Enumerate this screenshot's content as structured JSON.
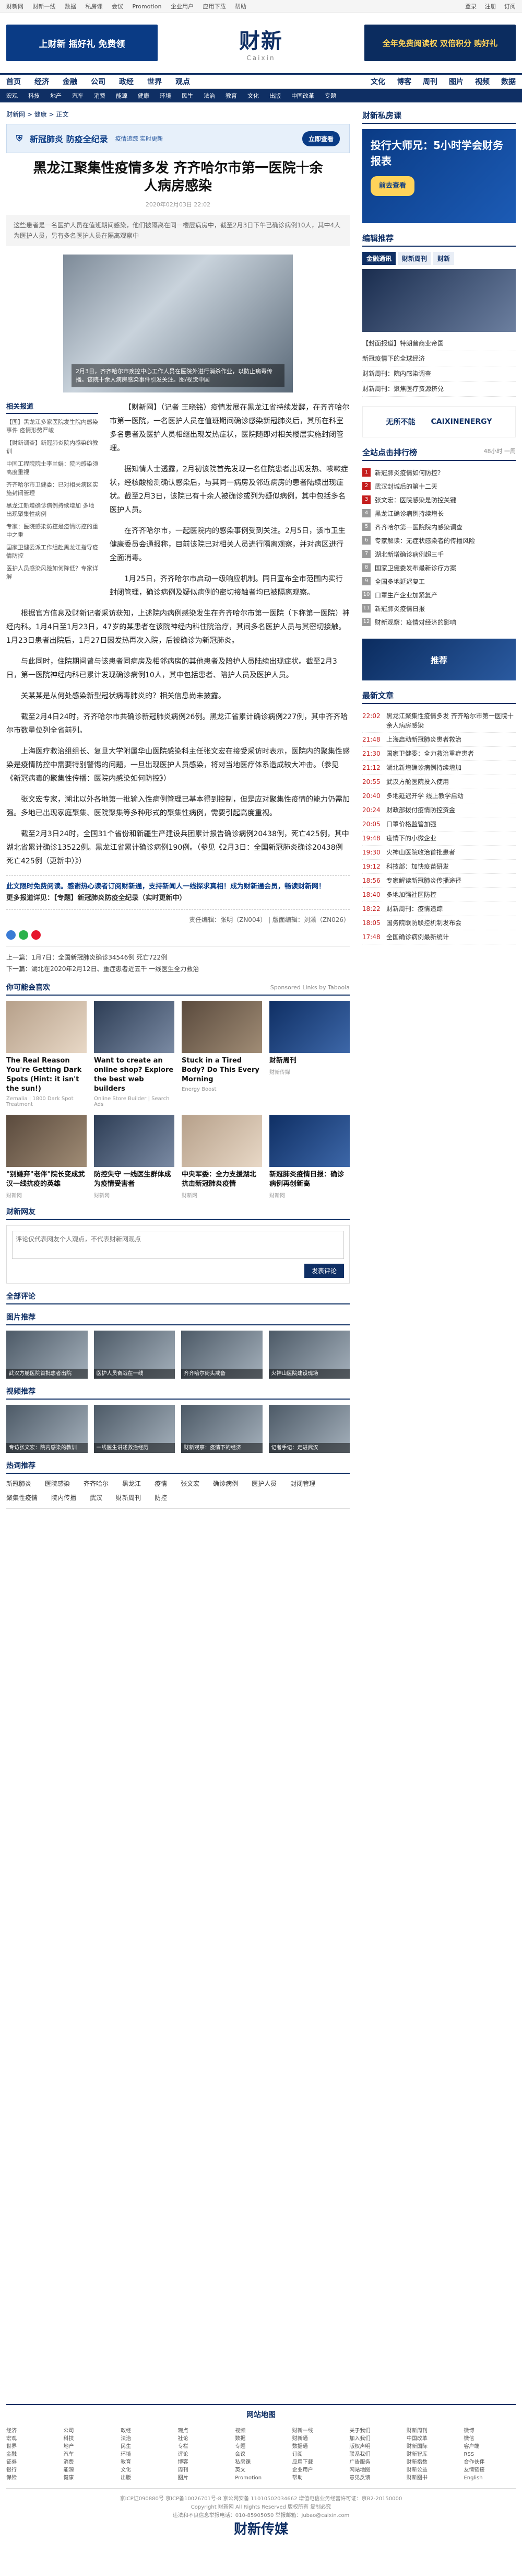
{
  "topbar": {
    "links": [
      "财新网",
      "财新一线",
      "数据",
      "私房课",
      "会议",
      "Promotion",
      "企业用户",
      "应用下载",
      "帮助"
    ],
    "login": "登录",
    "register": "注册",
    "subscribe": "订阅"
  },
  "header": {
    "left_banner": "上财新 摇好礼 免费领",
    "logo_cn": "财新",
    "logo_en": "Caixin",
    "right_banner": "全年免费阅读权 双倍积分 购好礼"
  },
  "nav1": {
    "items": [
      "首页",
      "经济",
      "金融",
      "公司",
      "政经",
      "世界",
      "观点"
    ],
    "right": [
      "文化",
      "博客",
      "周刊",
      "图片",
      "视频",
      "数据"
    ]
  },
  "nav2": {
    "items": [
      "宏观",
      "科技",
      "地产",
      "汽车",
      "消费",
      "能源",
      "健康",
      "环境",
      "民生",
      "法治",
      "教育",
      "文化",
      "出版",
      "中国改革",
      "专题"
    ]
  },
  "breadcrumb": "财新网 > 健康 > 正文",
  "adbar": {
    "title": "新冠肺炎 防疫全纪录",
    "sub": "疫情追踪 实时更新",
    "button": "立即查看"
  },
  "article": {
    "title": "黑龙江聚集性疫情多发 齐齐哈尔市第一医院十余人病房感染",
    "meta": "2020年02月03日 22:02",
    "summary": "这些患者是一名医护人员在值班期间感染，他们被隔离在同一楼层病房中，截至2月3日下午已确诊病例10人，其中4人为医护人员，另有多名医护人员在隔离观察中",
    "photo_caption": "2月3日，齐齐哈尔市疾控中心工作人员在医院外进行消杀作业，以防止病毒传播。该院十余人病房感染事件引发关注。图/视觉中国",
    "p1": "【财新网】（记者 王晓铭）疫情发展在黑龙江省持续发酵，在齐齐哈尔市第一医院，一名医护人员在值班期间确诊感染新冠肺炎后，其所在科室多名患者及医护人员相继出现发热症状，医院随即对相关楼层实施封闭管理。",
    "p2": "据知情人士透露，2月初该院首先发现一名住院患者出现发热、咳嗽症状，经核酸检测确认感染后，与其同一病房及邻近病房的患者陆续出现症状。截至2月3日，该院已有十余人被确诊或列为疑似病例，其中包括多名医护人员。",
    "p3": "在齐齐哈尔市，一起医院内的感染事例受到关注。2月5日，该市卫生健康委员会通报称，目前该院已对相关人员进行隔离观察，并对病区进行全面消毒。",
    "p4": "1月25日，齐齐哈尔市启动一级响应机制。同日宣布全市范围内实行封闭管理，确诊病例及疑似病例的密切接触者均已被隔离观察。",
    "p5": "根据官方信息及财新记者采访获知，上述院内病例感染发生在齐齐哈尔市第一医院（下称第一医院）神经内科。1月4日至1月23日，47岁的某患者在该院神经内科住院治疗，其间多名医护人员与其密切接触。1月23日患者出院后，1月27日因发热再次入院，后被确诊为新冠肺炎。",
    "p6": "与此同时，住院期间曾与该患者同病房及相邻病房的其他患者及陪护人员陆续出现症状。截至2月3日，第一医院神经内科已累计发现确诊病例10人，其中包括患者、陪护人员及医护人员。",
    "p7": "关某某是从何处感染新型冠状病毒肺炎的？相关信息尚未披露。",
    "p8": "截至2月4日24时，齐齐哈尔市共确诊新冠肺炎病例26例。黑龙江省累计确诊病例227例，其中齐齐哈尔市数量位列全省前列。",
    "p9": "上海医疗救治组组长、复旦大学附属华山医院感染科主任张文宏在接受采访时表示，医院内的聚集性感染是疫情防控中需要特别警惕的问题，一旦出现医护人员感染，将对当地医疗体系造成较大冲击。（参见《新冠病毒的聚集性传播：医院内感染如何防控》）",
    "p10": "张文宏专家，湖北以外各地第一批输入性病例管理已基本得到控制，但是应对聚集性疫情的能力仍需加强。多地已出现家庭聚集、医院聚集等多种形式的聚集性病例，需要引起高度重视。",
    "p11": "截至2月3日24时，全国31个省份和新疆生产建设兵团累计报告确诊病例20438例，死亡425例，其中湖北省累计确诊13522例。黑龙江省累计确诊病例190例。（参见《2月3日：全国新冠肺炎确诊20438例 死亡425例（更新中）》）",
    "promo": "此文限时免费阅读。感谢热心读者订阅财新通，支持新闻人一线探求真相！成为财新通会员，畅读财新网！",
    "promo2": "更多报道详见：【专题】新冠肺炎防疫全纪录（实时更新中）",
    "editor": "责任编辑：张明（ZN004） | 版面编辑：刘潇（ZN026）",
    "prev": "上一篇：1月7日：全国新冠肺炎确诊34546例 死亡722例",
    "next": "下一篇：湖北在2020年2月12日、重症患者近五千 一线医生全力救治"
  },
  "related": {
    "title": "相关报道",
    "items": [
      "【图】黑龙江多家医院发生院内感染事件 疫情形势严峻",
      "【财新调查】新冠肺炎院内感染的教训",
      "中国工程院院士李兰娟：院内感染须高度重视",
      "齐齐哈尔市卫健委：已对相关病区实施封闭管理",
      "黑龙江新增确诊病例持续增加 多地出现聚集性病例",
      "专家：医院感染防控是疫情防控的重中之重",
      "国家卫健委派工作组赴黑龙江指导疫情防控",
      "医护人员感染风险如何降低？专家详解"
    ]
  },
  "sections": {
    "recommend": "你可能会喜欢",
    "sponsored": "Sponsored Links by Taboola",
    "comment": "财新网友",
    "comment_placeholder": "评论仅代表网友个人观点，不代表财新网观点",
    "comment_button": "发表评论",
    "all_comments": "全部评论",
    "photos": "图片推荐",
    "video": "视频推荐",
    "hot": "热词推荐"
  },
  "cards": [
    {
      "title": "The Real Reason You're Getting Dark Spots (Hint: it isn't the sun!)",
      "src": "Zemalia | 1800 Dark Spot Treatment"
    },
    {
      "title": "Want to create an online shop? Explore the best web builders",
      "src": "Online Store Builder | Search Ads"
    },
    {
      "title": "Stuck in a Tired Body? Do This Every Morning",
      "src": "Energy Boost"
    },
    {
      "title": "财新周刊",
      "src": "财新传媒"
    },
    {
      "title": "\"别嫌弃\"老伴\"院长变成武汉一线抗疫的英雄",
      "src": "财新网"
    },
    {
      "title": "防控失守 一线医生群体成为疫情受害者",
      "src": "财新网"
    },
    {
      "title": "中央军委：全力支援湖北抗击新冠肺炎疫情",
      "src": "财新网"
    },
    {
      "title": "新冠肺炎疫情日报：确诊病例再创新高",
      "src": "财新网"
    }
  ],
  "photo_items": [
    "武汉方舱医院首批患者出院",
    "医护人员奋战在一线",
    "齐齐哈尔街头戒备",
    "火神山医院建设现场"
  ],
  "video_items": [
    "专访张文宏：院内感染的教训",
    "一线医生讲述救治经历",
    "财新观察：疫情下的经济",
    "记者手记：走进武汉"
  ],
  "hotwords": [
    "新冠肺炎",
    "医院感染",
    "齐齐哈尔",
    "黑龙江",
    "疫情",
    "张文宏",
    "确诊病例",
    "医护人员",
    "封闭管理",
    "聚集性疫情",
    "院内传播",
    "武汉",
    "财新周刊",
    "防控"
  ],
  "right": {
    "private_title": "财新私房课",
    "ad_text": "投行大师兄：5小时学会财务报表",
    "ad_btn": "前去查看",
    "mag_title": "编辑推荐",
    "mag_tabs": [
      "金融通讯",
      "财新周刊",
      "财新"
    ],
    "mag_list": [
      "【封面报道】特朗普商业帝国",
      "新冠疫情下的全球经济",
      "财新周刊：院内感染调查",
      "财新周刊：聚焦医疗资源挤兑"
    ],
    "rank_title": "全站点击排行榜",
    "rank_tabs": [
      "48小时",
      "一周"
    ],
    "rank": [
      "新冠肺炎疫情如何防控？",
      "武汉封城后的第十二天",
      "张文宏：医院感染是防控关键",
      "黑龙江确诊病例持续增长",
      "齐齐哈尔第一医院院内感染调查",
      "专家解读：无症状感染者的传播风险",
      "湖北新增确诊病例超三千",
      "国家卫健委发布最新诊疗方案",
      "全国多地延迟复工",
      "口罩生产企业加紧复产",
      "新冠肺炎疫情日报",
      "财新观察：疫情对经济的影响"
    ],
    "partner_title": "合作伙伴",
    "partners": [
      "无所不能",
      "CAIXINENERGY"
    ],
    "related_mag": "推荐",
    "news_title": "最新文章",
    "news": [
      {
        "t": "22:02",
        "s": "黑龙江聚集性疫情多发 齐齐哈尔市第一医院十余人病房感染"
      },
      {
        "t": "21:48",
        "s": "上海启动新冠肺炎患者救治"
      },
      {
        "t": "21:30",
        "s": "国家卫健委：全力救治重症患者"
      },
      {
        "t": "21:12",
        "s": "湖北新增确诊病例持续增加"
      },
      {
        "t": "20:55",
        "s": "武汉方舱医院投入使用"
      },
      {
        "t": "20:40",
        "s": "多地延迟开学 线上教学启动"
      },
      {
        "t": "20:24",
        "s": "财政部拨付疫情防控资金"
      },
      {
        "t": "20:05",
        "s": "口罩价格监管加强"
      },
      {
        "t": "19:48",
        "s": "疫情下的小微企业"
      },
      {
        "t": "19:30",
        "s": "火神山医院收治首批患者"
      },
      {
        "t": "19:12",
        "s": "科技部：加快疫苗研发"
      },
      {
        "t": "18:56",
        "s": "专家解读新冠肺炎传播途径"
      },
      {
        "t": "18:40",
        "s": "多地加强社区防控"
      },
      {
        "t": "18:22",
        "s": "财新周刊：疫情追踪"
      },
      {
        "t": "18:05",
        "s": "国务院联防联控机制发布会"
      },
      {
        "t": "17:48",
        "s": "全国确诊病例最新统计"
      }
    ]
  },
  "sitemap": {
    "title": "网站地图",
    "columns": [
      [
        "经济",
        "宏观",
        "世界",
        "金融",
        "证券",
        "银行",
        "保险"
      ],
      [
        "公司",
        "科技",
        "地产",
        "汽车",
        "消费",
        "能源",
        "健康"
      ],
      [
        "政经",
        "法治",
        "民生",
        "环境",
        "教育",
        "文化",
        "出版"
      ],
      [
        "观点",
        "社论",
        "专栏",
        "评论",
        "博客",
        "周刊",
        "图片"
      ],
      [
        "视频",
        "数据",
        "专题",
        "会议",
        "私房课",
        "英文",
        "Promotion"
      ],
      [
        "财新一线",
        "财新通",
        "数据通",
        "订阅",
        "应用下载",
        "企业用户",
        "帮助"
      ],
      [
        "关于我们",
        "加入我们",
        "版权声明",
        "联系我们",
        "广告服务",
        "网站地图",
        "意见反馈"
      ],
      [
        "财新周刊",
        "中国改革",
        "财新国际",
        "财新智库",
        "财新指数",
        "财新公益",
        "财新图书"
      ],
      [
        "微博",
        "微信",
        "客户端",
        "RSS",
        "合作伙伴",
        "友情链接",
        "English"
      ]
    ]
  },
  "footer": {
    "line1": "京ICP证090880号 京ICP备10026701号-8 京公网安备 11010502034662 增值电信业务经营许可证：京B2-20150000",
    "line2": "Copyright 财新网 All Rights Reserved 版权所有 复制必究",
    "line3": "违法和不良信息举报电话：010-85905050 举报邮箱：jubao@caixin.com",
    "logo": "财新传媒"
  }
}
